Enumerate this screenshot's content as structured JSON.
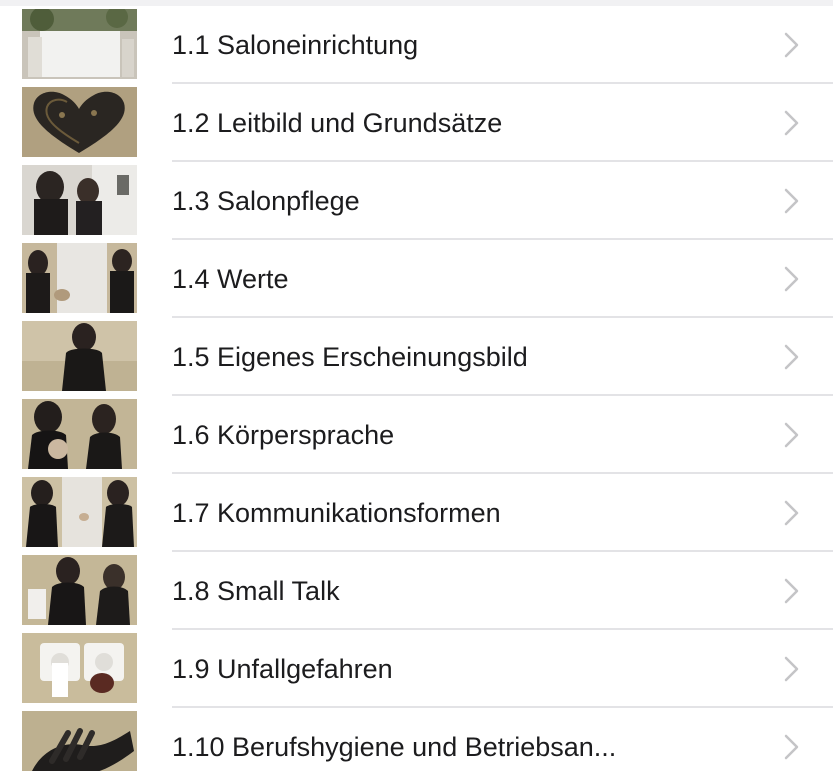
{
  "list": {
    "items": [
      {
        "label": "1.1 Saloneinrichtung",
        "thumbnail": "salon-furniture-photo"
      },
      {
        "label": "1.2 Leitbild und Grundsätze",
        "thumbnail": "heart-ornament-photo"
      },
      {
        "label": "1.3 Salonpflege",
        "thumbnail": "salon-care-photo"
      },
      {
        "label": "1.4 Werte",
        "thumbnail": "values-photo"
      },
      {
        "label": "1.5 Eigenes Erscheinungsbild",
        "thumbnail": "appearance-photo"
      },
      {
        "label": "1.6 Körpersprache",
        "thumbnail": "body-language-photo"
      },
      {
        "label": "1.7 Kommunikationsformen",
        "thumbnail": "communication-photo"
      },
      {
        "label": "1.8 Small Talk",
        "thumbnail": "small-talk-photo"
      },
      {
        "label": "1.9 Unfallgefahren",
        "thumbnail": "power-socket-photo"
      },
      {
        "label": "1.10 Berufshygiene und Betriebsan...",
        "thumbnail": "black-gloves-photo"
      }
    ]
  },
  "colors": {
    "text": "#1c1c1e",
    "chevron": "#c4c4c7",
    "separator": "#e3e3e6"
  },
  "icons": {
    "disclosure": "chevron-right-icon"
  }
}
